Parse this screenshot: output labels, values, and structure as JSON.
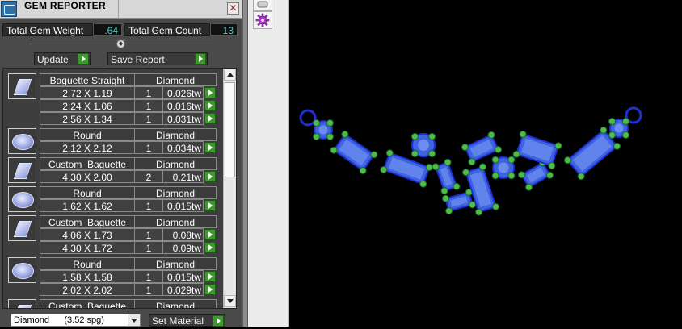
{
  "window": {
    "title": "GEM REPORTER",
    "close_glyph": "✕"
  },
  "stats": {
    "total_weight_label": "Total Gem Weight",
    "total_weight_value": ".64",
    "total_count_label": "Total Gem Count",
    "total_count_value": "13"
  },
  "actions": {
    "update_label": "Update",
    "save_report_label": "Save Report"
  },
  "gem_groups": [
    {
      "shape": "Baguette Straight",
      "material": "Diamond",
      "icon": "baguette-gem-icon",
      "rows": [
        {
          "size": "2.72 X 1.19",
          "qty": "1",
          "weight": "0.026tw"
        },
        {
          "size": "2.24 X 1.06",
          "qty": "1",
          "weight": "0.016tw"
        },
        {
          "size": "2.56 X 1.34",
          "qty": "1",
          "weight": "0.031tw"
        }
      ]
    },
    {
      "shape": "Round",
      "material": "Diamond",
      "icon": "round-gem-icon",
      "rows": [
        {
          "size": "2.12 X 2.12",
          "qty": "1",
          "weight": "0.034tw"
        }
      ]
    },
    {
      "shape": "Custom_Baguette",
      "material": "Diamond",
      "icon": "baguette-gem-icon",
      "rows": [
        {
          "size": "4.30 X 2.00",
          "qty": "2",
          "weight": "0.21tw"
        }
      ]
    },
    {
      "shape": "Round",
      "material": "Diamond",
      "icon": "round-gem-icon",
      "rows": [
        {
          "size": "1.62 X 1.62",
          "qty": "1",
          "weight": "0.015tw"
        }
      ]
    },
    {
      "shape": "Custom_Baguette",
      "material": "Diamond",
      "icon": "baguette-gem-icon",
      "rows": [
        {
          "size": "4.06 X 1.73",
          "qty": "1",
          "weight": "0.08tw"
        },
        {
          "size": "4.30 X 1.72",
          "qty": "1",
          "weight": "0.09tw"
        }
      ]
    },
    {
      "shape": "Round",
      "material": "Diamond",
      "icon": "round-gem-icon",
      "rows": [
        {
          "size": "1.58 X 1.58",
          "qty": "1",
          "weight": "0.015tw"
        },
        {
          "size": "2.02 X 2.02",
          "qty": "1",
          "weight": "0.029tw"
        }
      ]
    },
    {
      "shape": "Custom_Baguette",
      "material": "Diamond",
      "icon": "baguette-gem-icon",
      "rows": []
    }
  ],
  "material_select": {
    "value": "Diamond      (3.52 spg)"
  },
  "set_material_label": "Set Material",
  "toolstrip": [
    {
      "icon": "render-settings-icon"
    },
    {
      "icon": "gear-icon"
    }
  ],
  "colors": {
    "gem_blue": "#3d63e0",
    "gem_light": "#7fa0f5",
    "prong_green": "#4cbc4c",
    "wire_blue": "#1f2fd6",
    "go_green": "#3a9a2a",
    "stat_cyan": "#2fd9d0"
  }
}
